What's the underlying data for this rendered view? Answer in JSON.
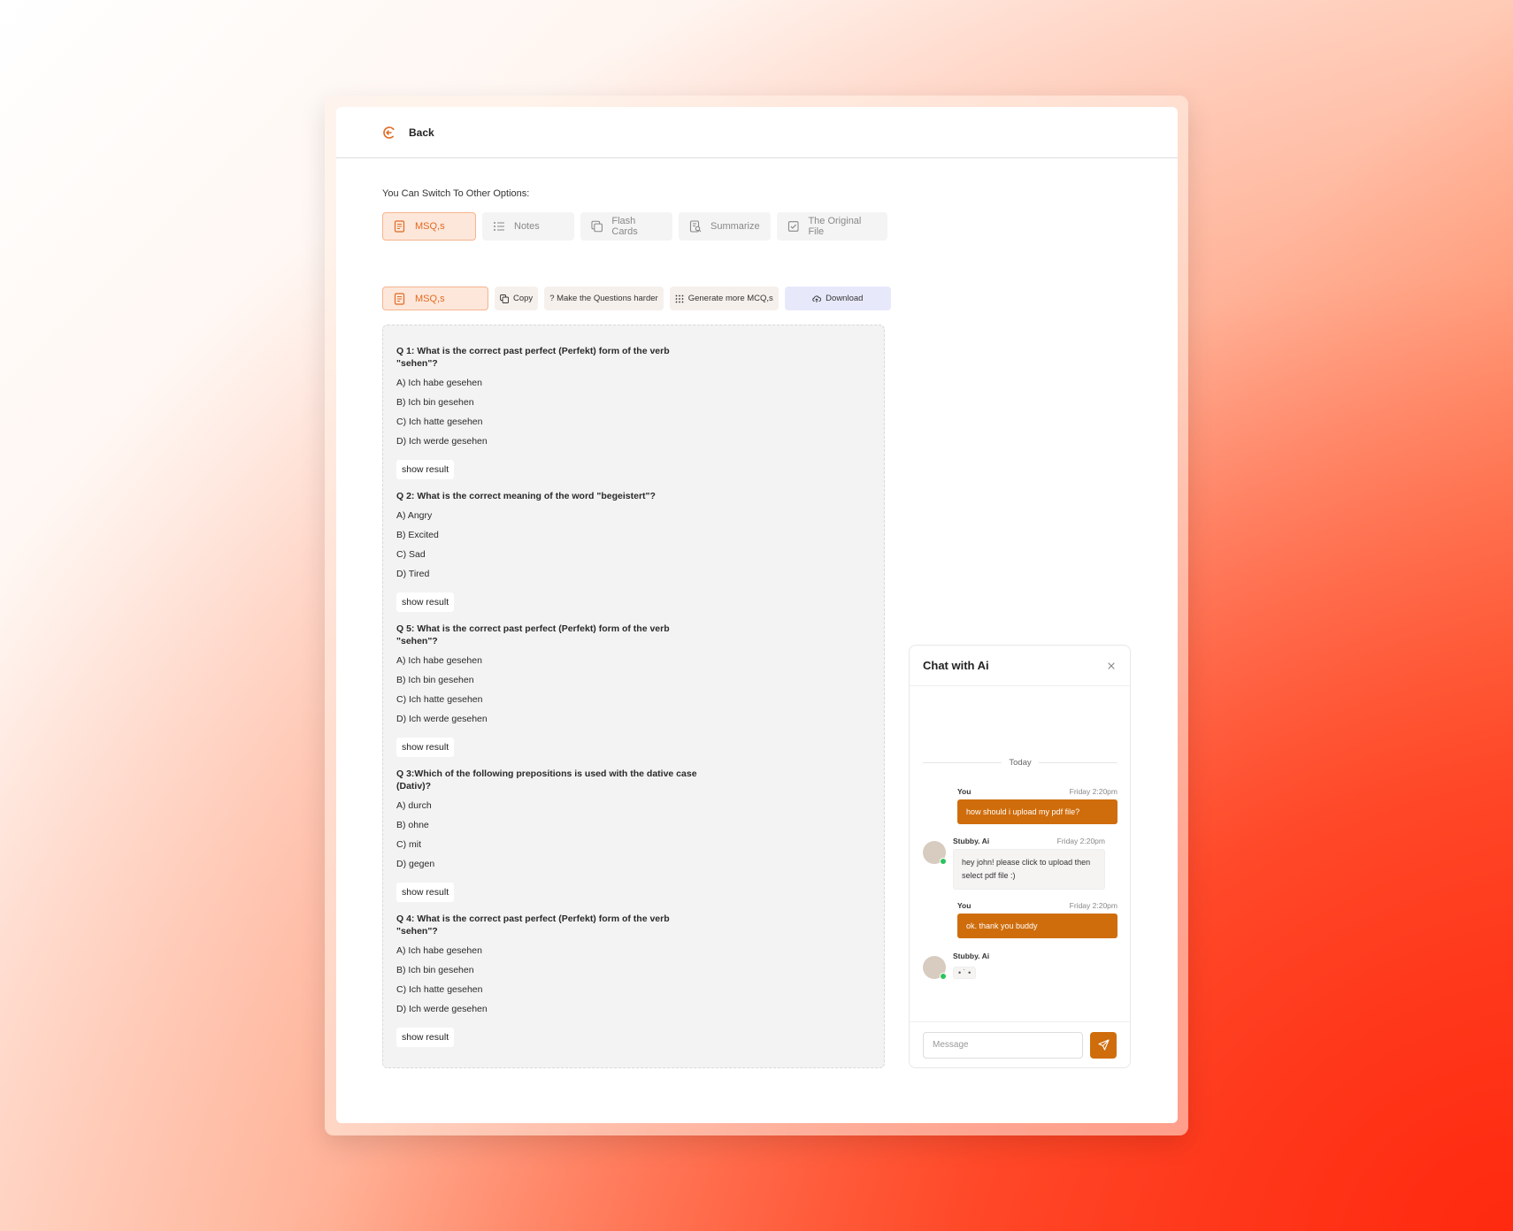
{
  "header": {
    "back_label": "Back"
  },
  "switch": {
    "title": "You Can Switch To Other Options:",
    "options": [
      {
        "label": "MSQ,s",
        "icon": "document-list-icon",
        "active": true
      },
      {
        "label": "Notes",
        "icon": "list-icon",
        "active": false
      },
      {
        "label": "Flash Cards",
        "icon": "cards-icon",
        "active": false
      },
      {
        "label": "Summarize",
        "icon": "document-search-icon",
        "active": false
      },
      {
        "label": "The Original File",
        "icon": "checkbox-icon",
        "active": false
      }
    ]
  },
  "toolbar": {
    "msq_label": "MSQ,s",
    "copy_label": "Copy",
    "harder_label": "? Make the Questions harder",
    "generate_label": "Generate more MCQ,s",
    "download_label": "Download"
  },
  "questions": [
    {
      "title": "Q 1: What is the correct past perfect (Perfekt) form of the verb \"sehen\"?",
      "options": [
        "A) Ich habe gesehen",
        "B) Ich bin gesehen",
        "C) Ich hatte gesehen",
        "D) Ich werde gesehen"
      ],
      "button": "show result"
    },
    {
      "title": "Q 2: What is the correct meaning of the word \"begeistert\"?",
      "options": [
        "A) Angry",
        "B) Excited",
        "C) Sad",
        "D) Tired"
      ],
      "button": "show result"
    },
    {
      "title": "Q 5: What is the correct past perfect (Perfekt) form of the verb \"sehen\"?",
      "options": [
        "A) Ich habe gesehen",
        "B) Ich bin gesehen",
        "C) Ich hatte gesehen",
        "D) Ich werde gesehen"
      ],
      "button": "show result"
    },
    {
      "title": "Q 3:Which of the following prepositions is used with the dative case (Dativ)?",
      "options": [
        "A) durch",
        "B) ohne",
        "C) mit",
        "D) gegen"
      ],
      "button": "show result"
    },
    {
      "title": "Q 4: What is the correct past perfect (Perfekt) form of the verb \"sehen\"?",
      "options": [
        "A) Ich habe gesehen",
        "B) Ich bin gesehen",
        "C) Ich hatte gesehen",
        "D) Ich werde gesehen"
      ],
      "button": "show result"
    }
  ],
  "chat": {
    "title": "Chat with Ai",
    "divider": "Today",
    "messages": [
      {
        "sender": "You",
        "time": "Friday 2:20pm",
        "text": "how should i upload my pdf file?"
      },
      {
        "sender": "Stubby. Ai",
        "time": "Friday 2:20pm",
        "text": "hey john! please click to upload then select pdf file :)"
      },
      {
        "sender": "You",
        "time": "Friday 2:20pm",
        "text": "ok. thank you buddy"
      },
      {
        "sender": "Stubby. Ai",
        "typing": "• ˙ •"
      }
    ],
    "input_placeholder": "Message"
  },
  "colors": {
    "accent": "#cf6d0c",
    "active_tab_bg": "#fde7da",
    "active_tab_text": "#e06a22",
    "download_bg": "#e7e9fb",
    "online": "#2ec25c"
  }
}
